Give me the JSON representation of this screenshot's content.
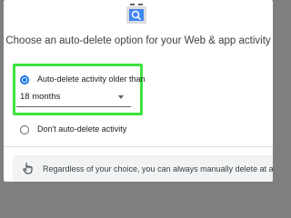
{
  "dialog": {
    "header_icon": "auto-delete-search-icon",
    "title": "Choose an auto-delete option for your Web & app activity",
    "options": [
      {
        "label": "Auto-delete activity older than",
        "checked": true
      },
      {
        "label": "Don't auto-delete activity",
        "checked": false
      }
    ],
    "duration_select": {
      "value": "18 months"
    },
    "info": {
      "icon": "hand-pointer-icon",
      "text": "Regardless of your choice, you can always manually delete at any time"
    }
  },
  "colors": {
    "accent": "#1a73e8",
    "highlight": "#3fe23f",
    "backdrop": "#7f7f7f"
  }
}
